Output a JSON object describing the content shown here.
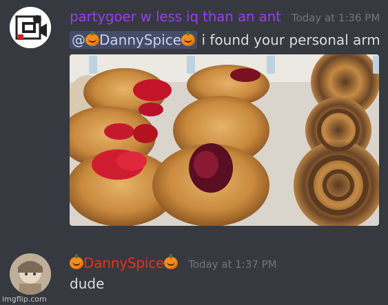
{
  "messages": [
    {
      "username": "partygoer w less iq than an ant",
      "username_color": "#9a3cf0",
      "timestamp": "Today at 1:36 PM",
      "mention": "@DannySpice",
      "mention_emoji": "pumpkin",
      "text": "i found your personal arm",
      "attachment": "pastries-photo"
    },
    {
      "username": "DannySpice",
      "username_color": "#e7321c",
      "username_emoji": "pumpkin",
      "timestamp": "Today at 1:37 PM",
      "text": "dude"
    }
  ],
  "watermark": "imgflip.com",
  "colors": {
    "background": "#36393f",
    "text": "#dcddde",
    "timestamp": "#72767d",
    "mention_bg": "#4a5181"
  }
}
